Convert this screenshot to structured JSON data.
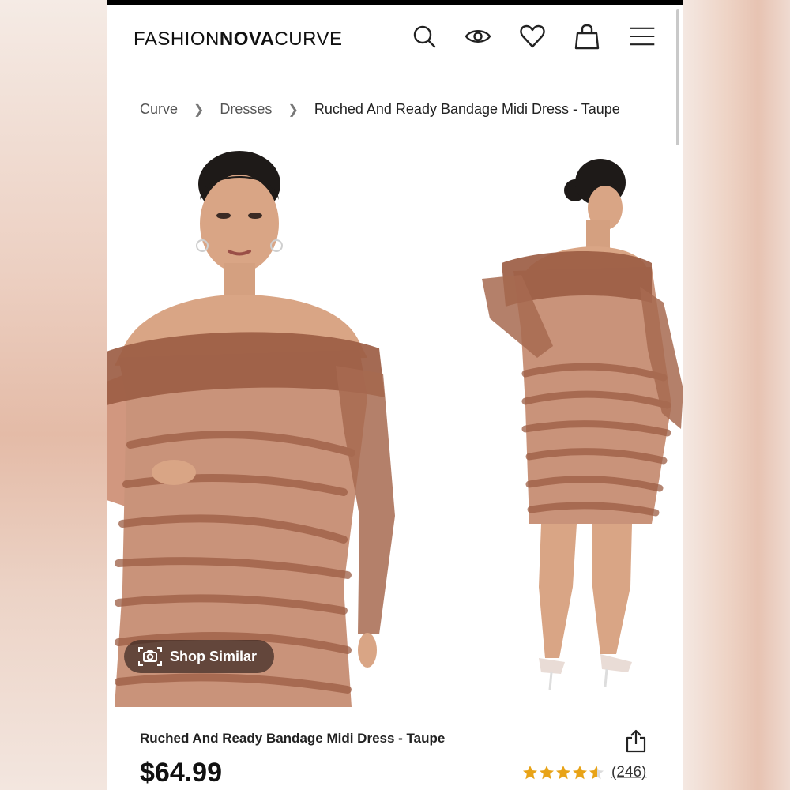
{
  "header": {
    "logo": {
      "part1": "FASHION",
      "part2": "NOVA",
      "part3": "CURVE"
    },
    "icons": [
      "search-icon",
      "eye-icon",
      "heart-icon",
      "bag-icon",
      "menu-icon"
    ]
  },
  "breadcrumb": [
    {
      "label": "Curve"
    },
    {
      "label": "Dresses"
    },
    {
      "label": "Ruched And Ready Bandage Midi Dress - Taupe"
    }
  ],
  "gallery": {
    "shop_similar_label": "Shop Similar",
    "colors": {
      "dress": "#b97a62",
      "mesh": "#9c5d44",
      "skin": "#d9a585",
      "hair": "#1e1a18"
    }
  },
  "product": {
    "title": "Ruched And Ready Bandage Midi Dress - Taupe",
    "price": "$64.99",
    "rating": 4.5,
    "review_count": "(246)",
    "star_color": "#e8a317"
  }
}
